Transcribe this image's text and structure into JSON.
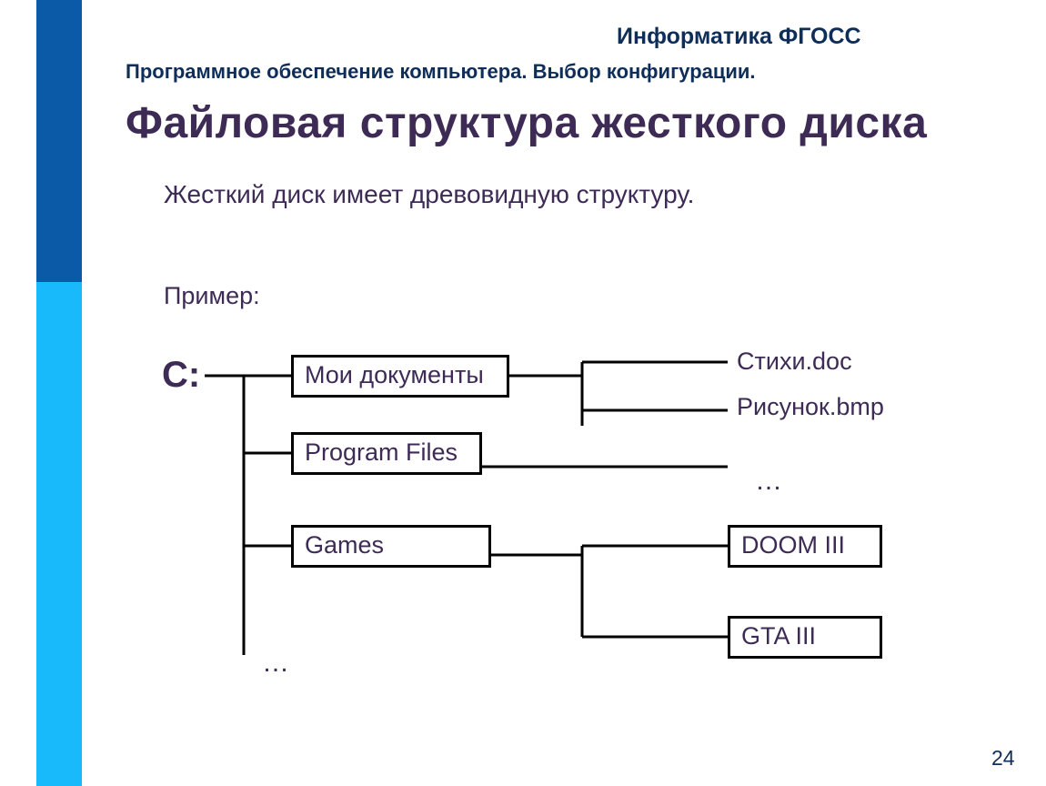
{
  "header": {
    "course": "Информатика ФГОСС",
    "subtitle": "Программное обеспечение компьютера. Выбор конфигурации.",
    "title": "Файловая структура жесткого диска"
  },
  "body": {
    "lead": "Жесткий диск имеет древовидную структуру.",
    "example_label": "Пример:"
  },
  "tree": {
    "drive": "C:",
    "folders": {
      "docs": {
        "label": "Мои документы",
        "files": [
          "Стихи.doc",
          "Рисунок.bmp"
        ]
      },
      "prog": {
        "label": "Program Files",
        "more": "…"
      },
      "games": {
        "label": "Games",
        "children": [
          "DOOM III",
          "GTA III"
        ]
      }
    },
    "root_more": "…"
  },
  "page_number": "24"
}
